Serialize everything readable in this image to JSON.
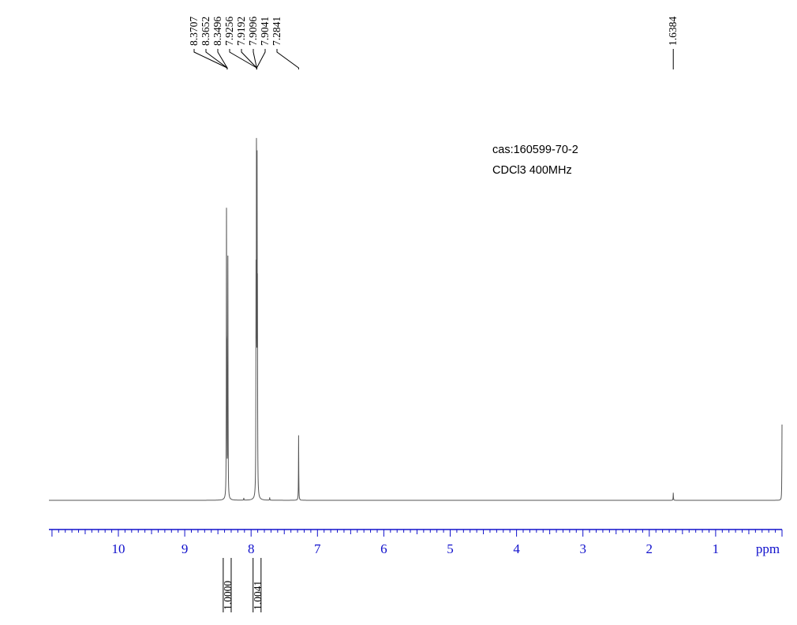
{
  "chart_data": {
    "type": "line",
    "xlabel": "ppm",
    "x_reversed": true,
    "xlim": [
      11,
      0
    ],
    "x_ticks": [
      "10",
      "9",
      "8",
      "7",
      "6",
      "5",
      "4",
      "3",
      "2",
      "1"
    ],
    "x_tick_values": [
      10,
      9,
      8,
      7,
      6,
      5,
      4,
      3,
      2,
      1
    ],
    "annotations": [
      "cas:160599-70-2",
      "CDCl3  400MHz"
    ],
    "peak_labels": [
      "8.3707",
      "8.3652",
      "8.3496",
      "7.9256",
      "7.9192",
      "7.9096",
      "7.9041",
      "7.2841",
      "1.6384"
    ],
    "peak_label_groups": [
      {
        "labels": [
          "8.3707",
          "8.3652",
          "8.3496"
        ],
        "ppm": 8.36
      },
      {
        "labels": [
          "7.9256",
          "7.9192",
          "7.9096",
          "7.9041"
        ],
        "ppm": 7.915
      },
      {
        "labels": [
          "7.2841"
        ],
        "ppm": 7.2841
      },
      {
        "labels": [
          "1.6384"
        ],
        "ppm": 1.6384
      }
    ],
    "integrals": [
      {
        "value": "1.0000",
        "from": 8.42,
        "to": 8.3
      },
      {
        "value": "1.0041",
        "from": 7.97,
        "to": 7.85
      }
    ],
    "series": [
      {
        "peaks": [
          {
            "ppm": 8.3707,
            "height": 0.5
          },
          {
            "ppm": 8.3652,
            "height": 0.2
          },
          {
            "ppm": 8.3496,
            "height": 0.44
          },
          {
            "ppm": 7.9256,
            "height": 0.35
          },
          {
            "ppm": 7.9192,
            "height": 0.58
          },
          {
            "ppm": 7.9096,
            "height": 0.55
          },
          {
            "ppm": 7.9041,
            "height": 0.3
          },
          {
            "ppm": 7.2841,
            "height": 0.12
          },
          {
            "ppm": 8.11,
            "height": 0.004
          },
          {
            "ppm": 7.72,
            "height": 0.005
          },
          {
            "ppm": 1.6384,
            "height": 0.014
          },
          {
            "ppm": 0.0,
            "height": 0.14
          }
        ],
        "baseline": 0
      }
    ],
    "colors": {
      "spectrum": "#555555",
      "axis": "#1010cc",
      "labels": "#000000"
    }
  }
}
